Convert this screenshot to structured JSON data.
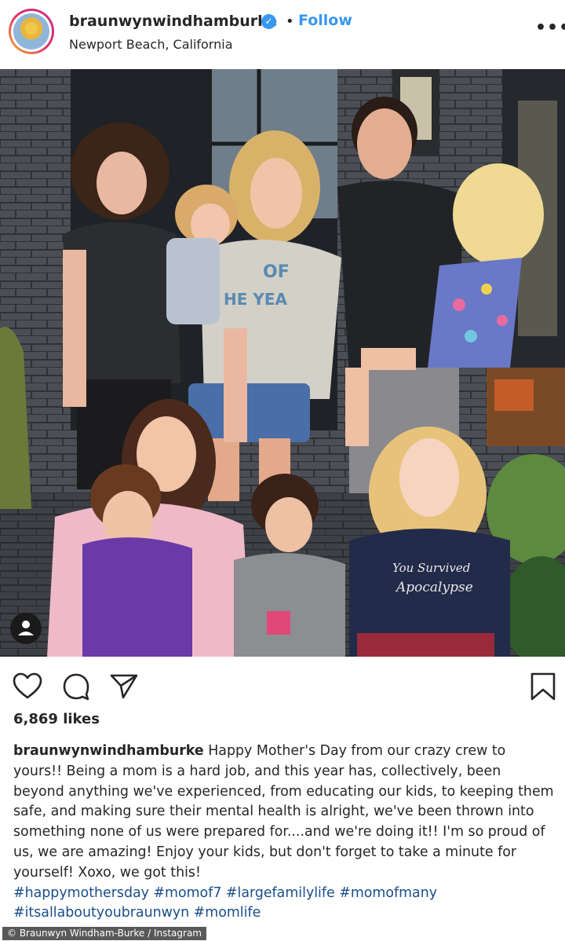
{
  "header": {
    "username": "braunwynwindhamburke",
    "verified_mark": "✓",
    "separator": "•",
    "follow_label": "Follow",
    "location": "Newport Beach, California",
    "more_label": "•••"
  },
  "photo": {
    "shirt_text_1": "OF",
    "shirt_text_2": "HE YEA",
    "tee_text_1": "You Survived",
    "tee_text_2": "Apocalypse"
  },
  "actions": {
    "like_icon": "heart-icon",
    "comment_icon": "comment-icon",
    "share_icon": "share-icon",
    "save_icon": "bookmark-icon"
  },
  "likes": "6,869 likes",
  "caption": {
    "username": "braunwynwindhamburke",
    "text": " Happy Mother's Day from our crazy crew to yours!! Being a mom is a hard job, and this year has, collectively, been beyond anything we've experienced, from educating our kids, to keeping them safe, and making sure their mental health is alright, we've been thrown into something none of us were prepared for....and we're doing it!! I'm so proud of us, we are amazing! Enjoy your kids, but don't forget to take a minute for yourself! Xoxo, we got this!\n",
    "hashtags": "#happymothersday #momof7 #largefamilylife #momofmany #itsallaboutyoubraunwyn #momlife"
  },
  "credit": "© Braunwyn Windham-Burke / Instagram",
  "colors": {
    "accent": "#3897f0",
    "hashtag": "#1a4e8a",
    "text": "#262626"
  }
}
